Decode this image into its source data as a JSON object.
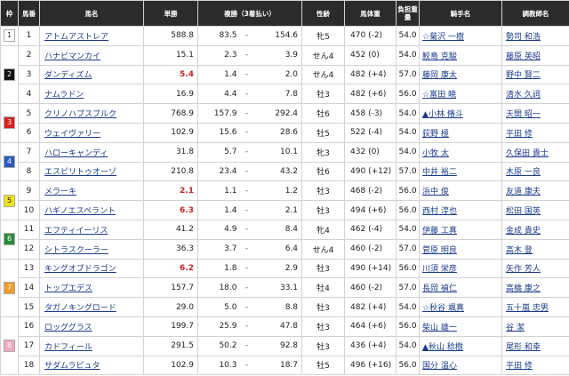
{
  "headers": {
    "waku": "枠",
    "umaban": "馬番",
    "name": "馬名",
    "odds": "単勝",
    "place": "複勝（3着払い）",
    "sexage": "性齢",
    "weight": "馬体重",
    "kinryo": "負担重量",
    "jockey": "騎手名",
    "trainer": "調教師名"
  },
  "frames": [
    {
      "num": "1",
      "color": "#ffffff",
      "text_color": "#333333",
      "rows": 1
    },
    {
      "num": "2",
      "color": "#111111",
      "text_color": "#ffffff",
      "rows": 3
    },
    {
      "num": "3",
      "color": "#d62020",
      "text_color": "#ffffff",
      "rows": 2
    },
    {
      "num": "4",
      "color": "#2a5cc4",
      "text_color": "#ffffff",
      "rows": 2
    },
    {
      "num": "5",
      "color": "#f2e21a",
      "text_color": "#222222",
      "rows": 2
    },
    {
      "num": "6",
      "color": "#2a8a3a",
      "text_color": "#ffffff",
      "rows": 2
    },
    {
      "num": "7",
      "color": "#f29a2e",
      "text_color": "#ffffff",
      "rows": 3
    },
    {
      "num": "8",
      "color": "#f3a7c2",
      "text_color": "#ffffff",
      "rows": 3
    }
  ],
  "horses": [
    {
      "num": "1",
      "name": "アトムアストレア",
      "odds": "588.8",
      "fav": false,
      "pmin": "83.5",
      "pmax": "154.6",
      "sexage": "牝5",
      "weight": "470 (-2)",
      "kinryo": "54.0",
      "jockey": "☆菊沢 一樹",
      "trainer": "勢司 和浩"
    },
    {
      "num": "2",
      "name": "ハナビマンカイ",
      "odds": "15.1",
      "fav": false,
      "pmin": "2.3",
      "pmax": "3.9",
      "sexage": "せん4",
      "weight": "452 (0)",
      "kinryo": "54.0",
      "jockey": "鮫島 克駿",
      "trainer": "藤原 英昭"
    },
    {
      "num": "3",
      "name": "ダンディズム",
      "odds": "5.4",
      "fav": true,
      "pmin": "1.4",
      "pmax": "2.0",
      "sexage": "せん4",
      "weight": "482 (+4)",
      "kinryo": "57.0",
      "jockey": "藤岡 康太",
      "trainer": "野中 賢二"
    },
    {
      "num": "4",
      "name": "ナムラドン",
      "odds": "16.9",
      "fav": false,
      "pmin": "4.4",
      "pmax": "7.8",
      "sexage": "牡3",
      "weight": "482 (+6)",
      "kinryo": "56.0",
      "jockey": "☆富田 暁",
      "trainer": "清水 久詞"
    },
    {
      "num": "5",
      "name": "クリノハプスブルク",
      "odds": "768.9",
      "fav": false,
      "pmin": "157.9",
      "pmax": "292.4",
      "sexage": "牡6",
      "weight": "458 (-3)",
      "kinryo": "54.0",
      "jockey": "▲小林 脩斗",
      "trainer": "天間 昭一"
    },
    {
      "num": "6",
      "name": "ウェイヴァリー",
      "odds": "102.9",
      "fav": false,
      "pmin": "15.6",
      "pmax": "28.6",
      "sexage": "牡5",
      "weight": "522 (-4)",
      "kinryo": "54.0",
      "jockey": "荻野 極",
      "trainer": "平田 修"
    },
    {
      "num": "7",
      "name": "ハローキャンディ",
      "odds": "31.8",
      "fav": false,
      "pmin": "5.7",
      "pmax": "10.1",
      "sexage": "牝3",
      "weight": "432 (0)",
      "kinryo": "54.0",
      "jockey": "小牧 太",
      "trainer": "久保田 貴士"
    },
    {
      "num": "8",
      "name": "エスピリトゥオーゾ",
      "odds": "210.8",
      "fav": false,
      "pmin": "23.4",
      "pmax": "43.2",
      "sexage": "牡6",
      "weight": "490 (+12)",
      "kinryo": "57.0",
      "jockey": "中井 裕二",
      "trainer": "木原 一良"
    },
    {
      "num": "9",
      "name": "メラーキ",
      "odds": "2.1",
      "fav": true,
      "pmin": "1.1",
      "pmax": "1.2",
      "sexage": "牡3",
      "weight": "468 (-2)",
      "kinryo": "56.0",
      "jockey": "浜中 俊",
      "trainer": "友道 康夫"
    },
    {
      "num": "10",
      "name": "ハギノエスペラント",
      "odds": "6.3",
      "fav": true,
      "pmin": "1.4",
      "pmax": "2.1",
      "sexage": "牡3",
      "weight": "494 (+6)",
      "kinryo": "56.0",
      "jockey": "西村 淳也",
      "trainer": "松田 国英"
    },
    {
      "num": "11",
      "name": "エフティイーリス",
      "odds": "41.2",
      "fav": false,
      "pmin": "4.9",
      "pmax": "8.4",
      "sexage": "牝4",
      "weight": "462 (-4)",
      "kinryo": "54.0",
      "jockey": "伊藤 工真",
      "trainer": "金成 貴史"
    },
    {
      "num": "12",
      "name": "シトラスクーラー",
      "odds": "36.3",
      "fav": false,
      "pmin": "3.7",
      "pmax": "6.4",
      "sexage": "せん4",
      "weight": "460 (-2)",
      "kinryo": "57.0",
      "jockey": "菅原 明良",
      "trainer": "高木 登"
    },
    {
      "num": "13",
      "name": "キングオブドラゴン",
      "odds": "6.2",
      "fav": true,
      "pmin": "1.8",
      "pmax": "2.9",
      "sexage": "牡3",
      "weight": "490 (+14)",
      "kinryo": "56.0",
      "jockey": "川須 栄彦",
      "trainer": "矢作 芳人"
    },
    {
      "num": "14",
      "name": "トップエデス",
      "odds": "157.7",
      "fav": false,
      "pmin": "18.0",
      "pmax": "33.1",
      "sexage": "牡4",
      "weight": "460 (-2)",
      "kinryo": "57.0",
      "jockey": "長岡 禎仁",
      "trainer": "高橋 康之"
    },
    {
      "num": "15",
      "name": "タガノキングロード",
      "odds": "29.0",
      "fav": false,
      "pmin": "5.0",
      "pmax": "8.8",
      "sexage": "牡3",
      "weight": "482 (+4)",
      "kinryo": "54.0",
      "jockey": "☆秋谷 颯真",
      "trainer": "五十嵐 忠男"
    },
    {
      "num": "16",
      "name": "ロッググラス",
      "odds": "199.7",
      "fav": false,
      "pmin": "25.9",
      "pmax": "47.8",
      "sexage": "牡3",
      "weight": "464 (+6)",
      "kinryo": "56.0",
      "jockey": "柴山 雄一",
      "trainer": "谷 潔"
    },
    {
      "num": "17",
      "name": "カドフィール",
      "odds": "291.5",
      "fav": false,
      "pmin": "50.2",
      "pmax": "92.8",
      "sexage": "牡3",
      "weight": "436 (+4)",
      "kinryo": "54.0",
      "jockey": "▲秋山 稔樹",
      "trainer": "尾形 和幸"
    },
    {
      "num": "18",
      "name": "サダムラピュタ",
      "odds": "102.9",
      "fav": false,
      "pmin": "10.3",
      "pmax": "18.7",
      "sexage": "牡5",
      "weight": "496 (+16)",
      "kinryo": "56.0",
      "jockey": "国分 温心",
      "trainer": "平田 修"
    }
  ]
}
